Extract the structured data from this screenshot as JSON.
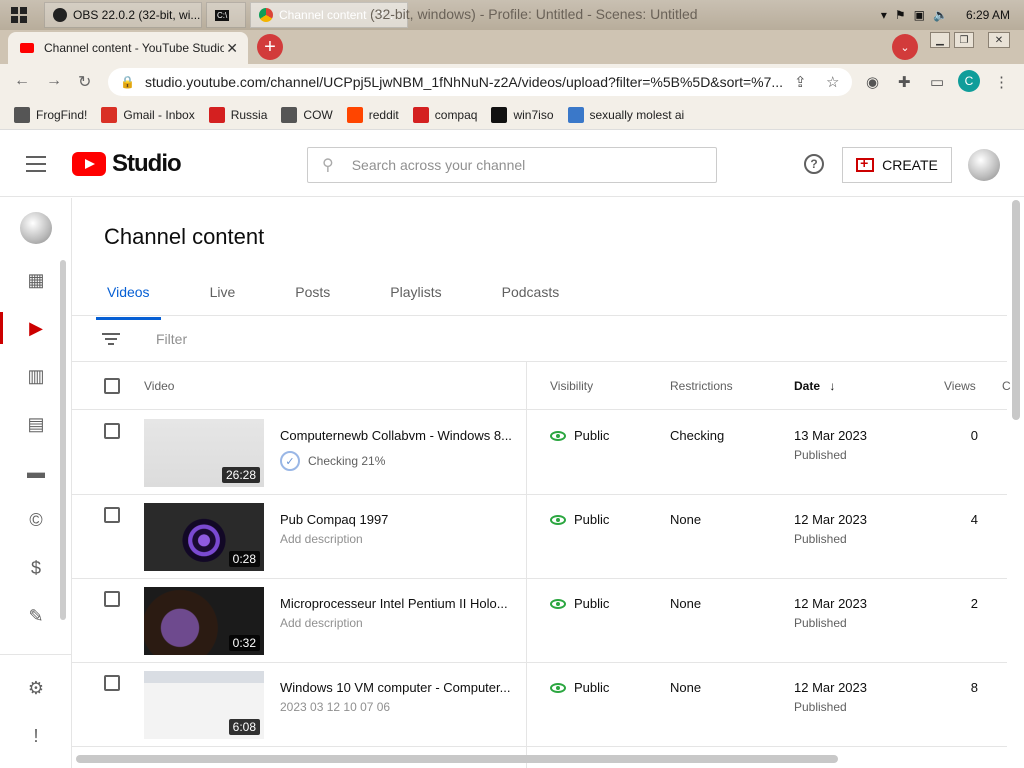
{
  "taskbar": {
    "obs_label": "OBS 22.0.2 (32-bit, wi...",
    "cmd_label": "C:\\",
    "chrome_label": "Channel content - Y...",
    "window_title": "(32-bit, windows) - Profile: Untitled - Scenes: Untitled",
    "time": "6:29 AM"
  },
  "tabbar": {
    "active_tab": "Channel content - YouTube Studio",
    "new_tab": "+",
    "tab_search": "⌄"
  },
  "address_bar": {
    "url": "studio.youtube.com/channel/UCPpj5LjwNBM_1fNhNuN-z2A/videos/upload?filter=%5B%5D&sort=%7...",
    "profile_initial": "C"
  },
  "bookmarks": [
    {
      "label": "FrogFind!",
      "icon": "globe-icon",
      "color": "#555555"
    },
    {
      "label": "Gmail - Inbox",
      "icon": "gmail-icon",
      "color": "#d93025"
    },
    {
      "label": "Russia",
      "icon": "flag-icon",
      "color": "#d42020"
    },
    {
      "label": "COW",
      "icon": "globe-icon",
      "color": "#555555"
    },
    {
      "label": "reddit",
      "icon": "reddit-icon",
      "color": "#ff4500"
    },
    {
      "label": "compaq",
      "icon": "compaq-icon",
      "color": "#d42020"
    },
    {
      "label": "win7iso",
      "icon": "tw-icon",
      "color": "#111111"
    },
    {
      "label": "sexually molest ai",
      "icon": "doc-icon",
      "color": "#3a78c9"
    }
  ],
  "studio": {
    "logo_text": "Studio",
    "search_placeholder": "Search across your channel",
    "help": "?",
    "create_label": "CREATE"
  },
  "main": {
    "page_title": "Channel content",
    "tabs": [
      "Videos",
      "Live",
      "Posts",
      "Playlists",
      "Podcasts"
    ],
    "filter_placeholder": "Filter",
    "columns": {
      "video": "Video",
      "visibility": "Visibility",
      "restrictions": "Restrictions",
      "date": "Date",
      "date_sort": "↓",
      "views": "Views",
      "comments": "C"
    },
    "rows": [
      {
        "title": "Computernewb Collabvm - Windows 8...",
        "subtitle": "Checking 21%",
        "duration": "26:28",
        "visibility": "Public",
        "restrictions": "Checking",
        "date": "13 Mar 2023",
        "date_status": "Published",
        "views": "0"
      },
      {
        "title": "Pub Compaq 1997",
        "subtitle": "Add description",
        "duration": "0:28",
        "visibility": "Public",
        "restrictions": "None",
        "date": "12 Mar 2023",
        "date_status": "Published",
        "views": "4"
      },
      {
        "title": "Microprocesseur Intel Pentium II Holo...",
        "subtitle": "Add description",
        "duration": "0:32",
        "visibility": "Public",
        "restrictions": "None",
        "date": "12 Mar 2023",
        "date_status": "Published",
        "views": "2"
      },
      {
        "title": "Windows 10 VM computer - Computer...",
        "subtitle": "2023 03 12 10 07 06",
        "duration": "6:08",
        "visibility": "Public",
        "restrictions": "None",
        "date": "12 Mar 2023",
        "date_status": "Published",
        "views": "8"
      }
    ]
  },
  "colors": {
    "accent_red": "#ff0000",
    "active_tab_blue": "#065fd4",
    "public_green": "#2ba640"
  }
}
